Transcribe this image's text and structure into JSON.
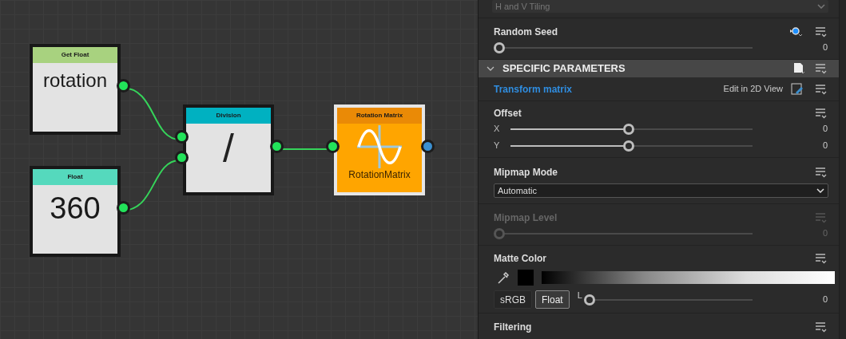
{
  "graph": {
    "nodes": [
      {
        "kind": "value",
        "title": "Get Float",
        "label": "rotation",
        "color": "#a8d27f",
        "outputs": [
          {
            "color": "#22e35a"
          }
        ]
      },
      {
        "kind": "value",
        "title": "Float",
        "label": "360",
        "color": "#55d9bd",
        "outputs": [
          {
            "color": "#22e35a"
          }
        ]
      },
      {
        "kind": "operator",
        "title": "Division",
        "label": "/",
        "color": "#00b1c1",
        "inputs": [
          {
            "color": "#22e35a"
          },
          {
            "color": "#22e35a"
          }
        ],
        "outputs": [
          {
            "color": "#22e35a"
          }
        ]
      },
      {
        "kind": "function",
        "title": "Rotation Matrix",
        "label": "RotationMatrix",
        "color": "#ea8a06",
        "inputs": [
          {
            "color": "#22e35a"
          }
        ],
        "outputs": [
          {
            "color": "#3b8fd0"
          }
        ]
      }
    ]
  },
  "panel": {
    "top_dropdown": {
      "value": "H and V Tiling"
    },
    "params": [
      {
        "kind": "slider",
        "label": "Random Seed",
        "randomize": true,
        "disabled": false,
        "level": 0,
        "value": "0"
      },
      {
        "kind": "section",
        "label": "SPECIFIC PARAMETERS",
        "expanded": true
      },
      {
        "kind": "link",
        "label": "Transform matrix",
        "action": "Edit in 2D View"
      },
      {
        "kind": "vector",
        "label": "Offset",
        "components": [
          {
            "axis": "X",
            "level": 0.5,
            "value": "0"
          },
          {
            "axis": "Y",
            "level": 0.5,
            "value": "0"
          }
        ]
      },
      {
        "kind": "select",
        "label": "Mipmap Mode",
        "value": "Automatic"
      },
      {
        "kind": "slider",
        "label": "Mipmap Level",
        "randomize": false,
        "disabled": true,
        "level": 0,
        "value": "0"
      },
      {
        "kind": "color",
        "label": "Matte Color",
        "color": "#000000",
        "modes": [
          {
            "label": "sRGB",
            "selected": false
          },
          {
            "label": "Float",
            "selected": true
          }
        ],
        "channel": "L",
        "level": 0,
        "value": "0"
      },
      {
        "kind": "header",
        "label": "Filtering"
      }
    ]
  }
}
